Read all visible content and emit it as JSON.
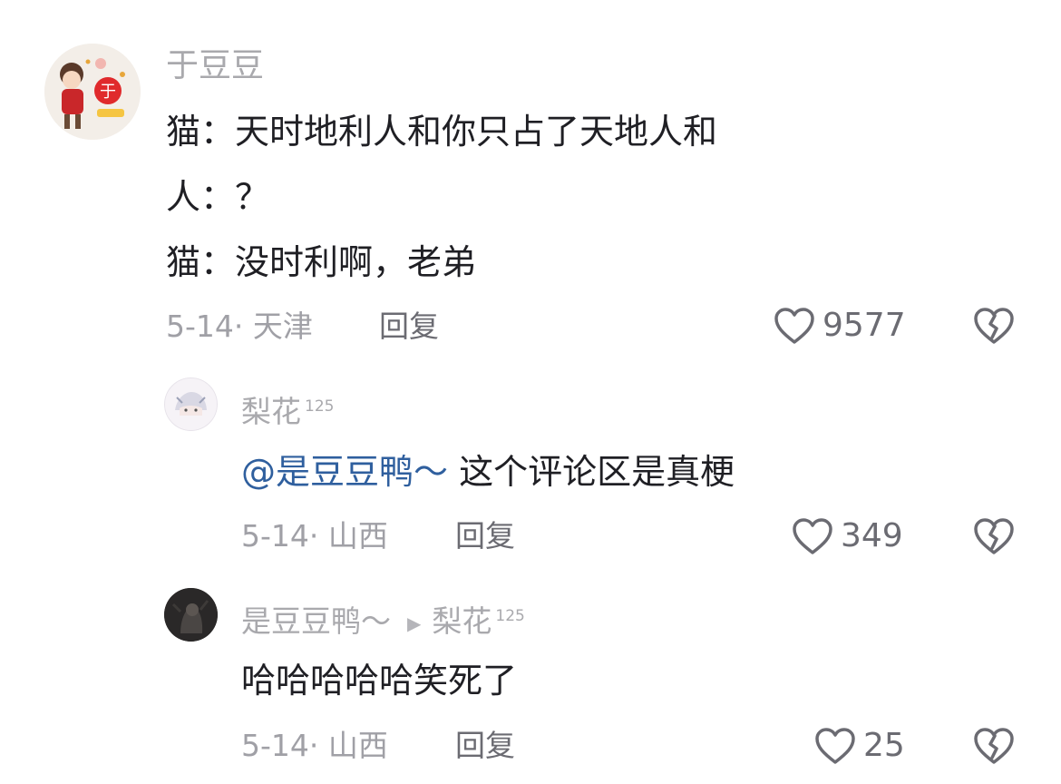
{
  "colors": {
    "mention": "#2f5f9e",
    "text": "#1f1f24",
    "meta": "#a0a0a6",
    "icon": "#6b6b72"
  },
  "comments": [
    {
      "username": "于豆豆",
      "lines": [
        "猫：天时地利人和你只占了天地人和",
        "人：？",
        "猫：没时利啊，老弟"
      ],
      "date_location": "5-14· 天津",
      "reply_label": "回复",
      "likes": "9577",
      "avatar_text": "于"
    },
    {
      "username": "梨花",
      "level": "125",
      "mention": "@是豆豆鸭～",
      "text": " 这个评论区是真梗",
      "date_location": "5-14· 山西",
      "reply_label": "回复",
      "likes": "349"
    },
    {
      "username": "是豆豆鸭～",
      "reply_to": "梨花",
      "reply_to_level": "125",
      "text": "哈哈哈哈哈笑死了",
      "date_location": "5-14· 山西",
      "reply_label": "回复",
      "likes": "25"
    }
  ]
}
